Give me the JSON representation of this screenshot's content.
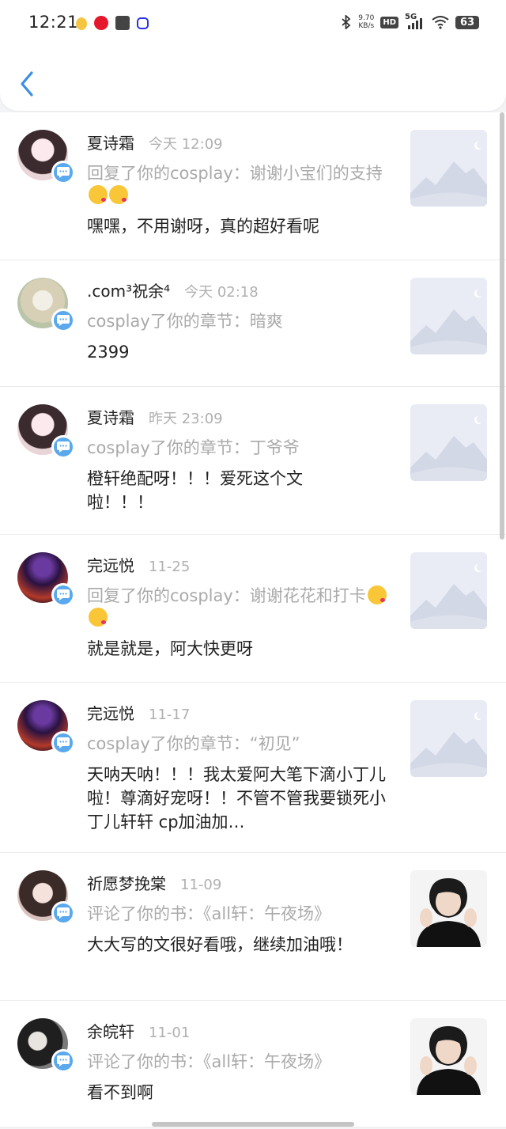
{
  "status_bar": {
    "time": "12:21",
    "net_speed_value": "9.70",
    "net_speed_unit": "KB/s",
    "hd": "HD",
    "network": "5G",
    "battery": "63",
    "icons": [
      "qq-icon",
      "weibo-icon",
      "mail-icon",
      "baidu-icon",
      "bluetooth-icon",
      "signal-icon",
      "wifi-icon",
      "battery-icon"
    ]
  },
  "nav": {
    "back_icon": "chevron-left-icon"
  },
  "colors": {
    "accent": "#3a8ee6",
    "badge": "#5aa8ee",
    "muted": "#aaaaaa"
  },
  "notifications": [
    {
      "name": "夏诗霜",
      "date": "今天 12:09",
      "action": "回复了你的cosplay：谢谢小宝们的支持",
      "action_emojis": 2,
      "comment": "嘿嘿，不用谢呀，真的超好看呢",
      "avatar": "avatar-girl-pink",
      "thumb": "placeholder"
    },
    {
      "name": ".com³祝余⁴",
      "date": "今天 02:18",
      "action": "cosplay了你的章节：暗爽",
      "action_emojis": 0,
      "comment": "2399",
      "avatar": "avatar-blonde",
      "thumb": "placeholder"
    },
    {
      "name": "夏诗霜",
      "date": "昨天 23:09",
      "action": "cosplay了你的章节：丁爷爷",
      "action_emojis": 0,
      "comment": "橙轩绝配呀！！！爱死这个文啦！！！",
      "avatar": "avatar-girl-pink",
      "thumb": "placeholder"
    },
    {
      "name": "完远悦",
      "date": "11-25",
      "action": "回复了你的cosplay：谢谢花花和打卡",
      "action_emojis": 2,
      "comment": "就是就是，阿大快更呀",
      "avatar": "avatar-concert",
      "thumb": "placeholder"
    },
    {
      "name": "完远悦",
      "date": "11-17",
      "action": "cosplay了你的章节：“初见”",
      "action_emojis": 0,
      "comment": "天呐天呐！！！我太爱阿大笔下滴小丁儿啦！尊滴好宠呀！！不管不管我要锁死小丁儿轩轩 cp加油加…",
      "avatar": "avatar-concert",
      "thumb": "placeholder"
    },
    {
      "name": "祈愿梦挽棠",
      "date": "11-09",
      "action": "评论了你的书：《all轩：午夜场》",
      "action_emojis": 0,
      "comment": "大大写的文很好看哦，继续加油哦！",
      "avatar": "avatar-girl-dark",
      "thumb": "book-cover"
    },
    {
      "name": "余皖轩",
      "date": "11-01",
      "action": "评论了你的书：《all轩：午夜场》",
      "action_emojis": 0,
      "comment": "看不到啊",
      "avatar": "avatar-boy-dark",
      "thumb": "book-cover"
    }
  ]
}
